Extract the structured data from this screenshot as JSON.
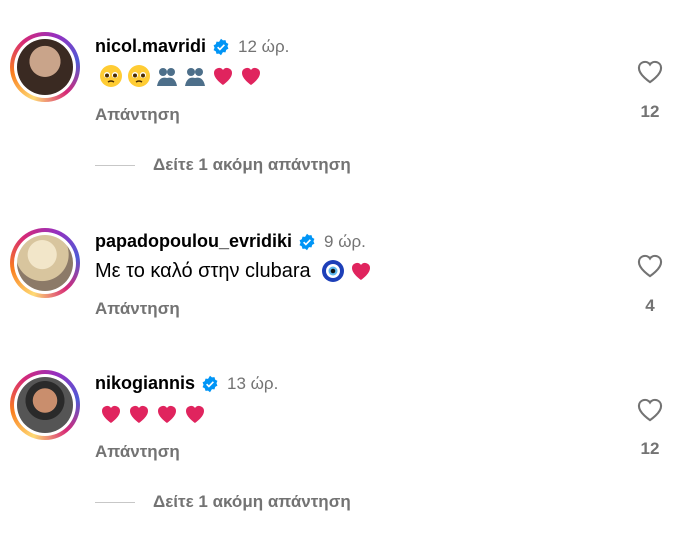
{
  "comments": [
    {
      "username": "nicol.mavridi",
      "time": "12 ώρ.",
      "text": "",
      "emoji": [
        "pleading-face",
        "pleading-face",
        "people-hugging",
        "people-hugging",
        "red-heart",
        "red-heart"
      ],
      "reply_label": "Απάντηση",
      "likes": "12",
      "more_replies": "Δείτε 1 ακόμη απάντηση"
    },
    {
      "username": "papadopoulou_evridiki",
      "time": "9 ώρ.",
      "text": "Με το καλό στην clubara",
      "emoji": [
        "nazar-amulet",
        "red-heart"
      ],
      "reply_label": "Απάντηση",
      "likes": "4"
    },
    {
      "username": "nikogiannis",
      "time": "13 ώρ.",
      "text": "",
      "emoji": [
        "red-heart",
        "red-heart",
        "red-heart",
        "red-heart"
      ],
      "reply_label": "Απάντηση",
      "likes": "12",
      "more_replies": "Δείτε 1 ακόμη απάντηση"
    }
  ],
  "colors": {
    "verified": "#0095f6",
    "secondary_text": "#737373",
    "heart": "#e0245e"
  }
}
